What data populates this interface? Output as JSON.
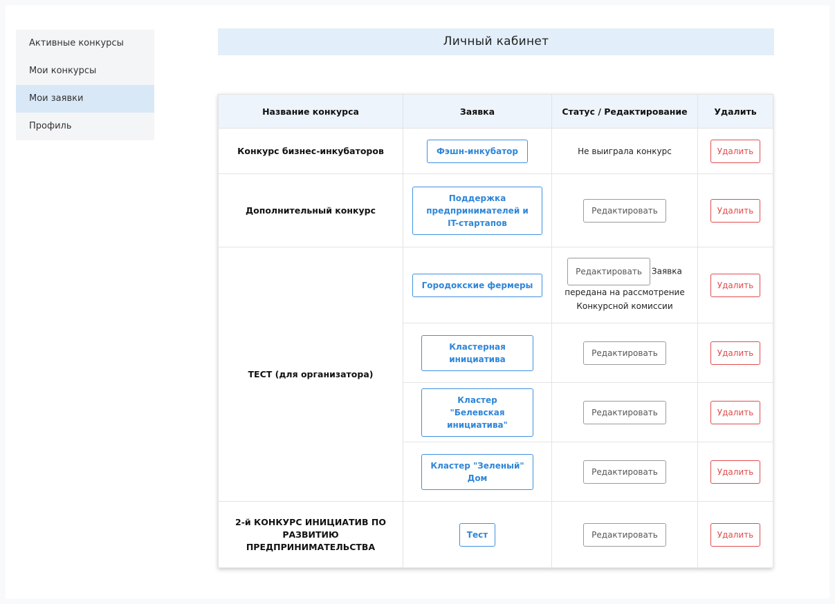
{
  "sidebar": {
    "items": [
      {
        "label": "Активные конкурсы",
        "active": false
      },
      {
        "label": "Мои конкурсы",
        "active": false
      },
      {
        "label": "Мои заявки",
        "active": true
      },
      {
        "label": "Профиль",
        "active": false
      }
    ]
  },
  "header": {
    "title": "Личный кабинет"
  },
  "table": {
    "columns": [
      "Название конкурса",
      "Заявка",
      "Статус / Редактирование",
      "Удалить"
    ],
    "edit_label": "Редактировать",
    "delete_label": "Удалить",
    "rows": [
      {
        "contest": "Конкурс бизнес-инкубаторов",
        "application": "Фэшн-инкубатор",
        "status": "Не выиграла конкурс"
      },
      {
        "contest": "Дополнительный конкурс",
        "application": "Поддержка предпринимателей и IT-стартапов",
        "status": ""
      },
      {
        "contest": "ТЕСТ (для организатора)",
        "application": "Городокские фермеры",
        "status": "Заявка передана на рассмотрение Конкурсной комиссии"
      },
      {
        "contest": "",
        "application": "Кластерная инициатива",
        "status": ""
      },
      {
        "contest": "",
        "application": "Кластер \"Белевская инициатива\"",
        "status": ""
      },
      {
        "contest": "",
        "application": "Кластер \"Зеленый\" Дом",
        "status": ""
      },
      {
        "contest": "2-й КОНКУРС ИНИЦИАТИВ ПО РАЗВИТИЮ ПРЕДПРИНИМАТЕЛЬСТВА",
        "application": "Тест",
        "status": ""
      }
    ]
  }
}
